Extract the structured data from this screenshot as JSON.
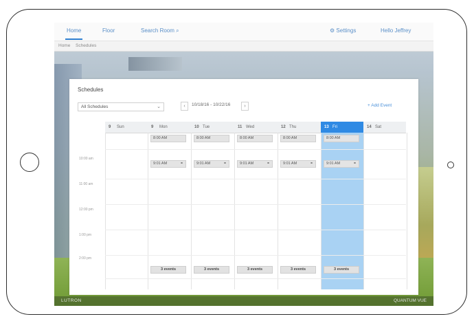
{
  "nav": {
    "tabs": [
      {
        "label": "Home"
      },
      {
        "label": "Floor"
      },
      {
        "label": "Search Room"
      }
    ],
    "settings_label": "Settings",
    "user_label": "Hello Jeffrey"
  },
  "breadcrumb": {
    "items": [
      "Home",
      "Schedules"
    ]
  },
  "schedules": {
    "title": "Schedules",
    "filter_value": "All Schedules",
    "date_range": "10/18/16 - 10/22/16",
    "add_event_label": "+ Add Event",
    "days": [
      {
        "num": "9",
        "name": "Sun"
      },
      {
        "num": "9",
        "name": "Mon"
      },
      {
        "num": "10",
        "name": "Tue"
      },
      {
        "num": "11",
        "name": "Wed"
      },
      {
        "num": "12",
        "name": "Thu"
      },
      {
        "num": "13",
        "name": "Fri"
      },
      {
        "num": "14",
        "name": "Sat"
      }
    ],
    "today_index": 5,
    "time_labels": [
      "",
      "10:00 am",
      "11:00 am",
      "12:00 pm",
      "1:00 pm",
      "2:00 pm"
    ],
    "row1_events": [
      "8:00 AM",
      "8:00 AM",
      "8:00 AM",
      "8:00 AM",
      "8:00 AM"
    ],
    "row2_events": [
      "9:01 AM",
      "9:01 AM",
      "9:01 AM",
      "9:01 AM",
      "9:01 AM"
    ],
    "allday_events": [
      "3 events",
      "3 events",
      "3 events",
      "3 events",
      "3 events"
    ]
  },
  "footer": {
    "brand": "LUTRON",
    "right_text": "QUANTUM VUE"
  },
  "colors": {
    "accent": "#2f8ae4",
    "today_column": "#a9d2f3",
    "link": "#4a90d9"
  },
  "icons": {
    "device_home_button": "home-button",
    "search": "search-icon",
    "settings": "gear-icon",
    "select_chevron": "chevron-down-icon",
    "event_action": "people-icon"
  }
}
